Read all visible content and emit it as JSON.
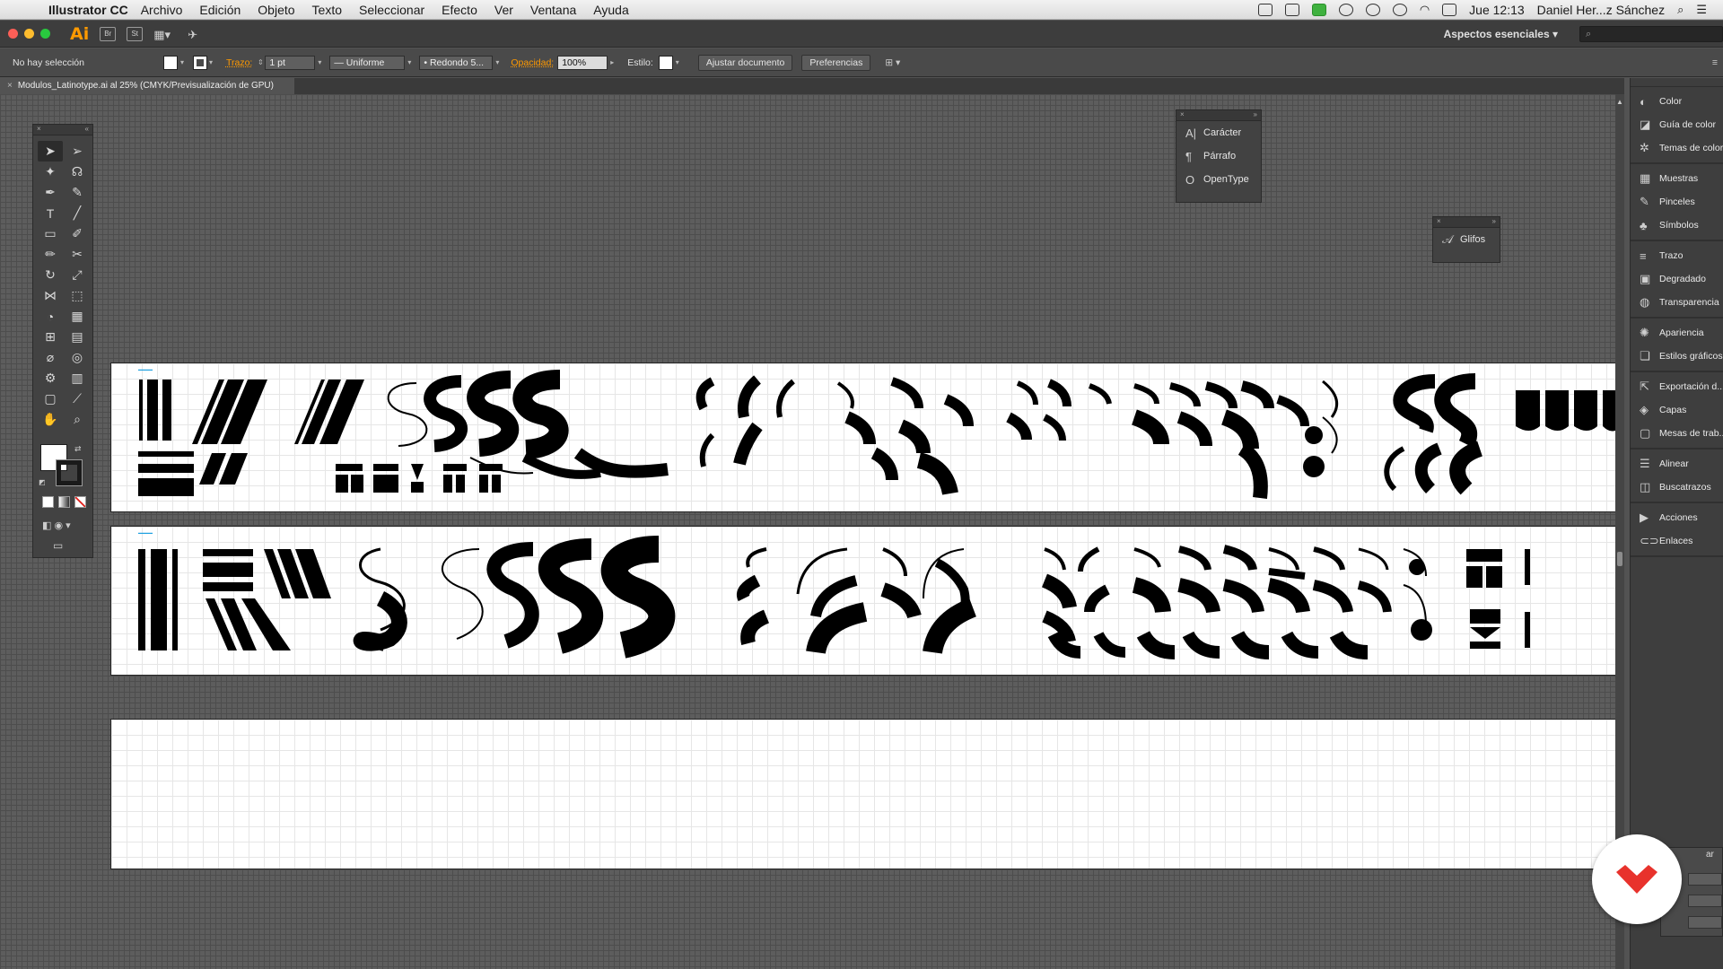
{
  "menubar": {
    "app_name": "Illustrator CC",
    "items": [
      "Archivo",
      "Edición",
      "Objeto",
      "Texto",
      "Seleccionar",
      "Efecto",
      "Ver",
      "Ventana",
      "Ayuda"
    ],
    "clock": "Jue 12:13",
    "user": "Daniel Her...z Sánchez"
  },
  "appbar": {
    "logo": "Ai",
    "bridge": "Br",
    "stock": "St",
    "workspace": "Aspectos esenciales"
  },
  "controlbar": {
    "selection": "No hay selección",
    "stroke_label": "Trazo:",
    "stroke_value": "1 pt",
    "profile": "Uniforme",
    "brush": "Redondo 5...",
    "opacity_label": "Opacidad:",
    "opacity_value": "100%",
    "style_label": "Estilo:",
    "doc_setup": "Ajustar documento",
    "preferences": "Preferencias"
  },
  "document": {
    "tab_title": "Modulos_Latinotype.ai al 25% (CMYK/Previsualización de GPU)"
  },
  "floating": {
    "type_panel": [
      "Carácter",
      "Párrafo",
      "OpenType"
    ],
    "glyphs": "Glifos"
  },
  "dock": {
    "groups": [
      [
        "Color",
        "Guía de color",
        "Temas de color"
      ],
      [
        "Muestras",
        "Pinceles",
        "Símbolos"
      ],
      [
        "Trazo",
        "Degradado",
        "Transparencia"
      ],
      [
        "Apariencia",
        "Estilos gráficos"
      ],
      [
        "Exportación d...",
        "Capas",
        "Mesas de trab..."
      ],
      [
        "Alinear",
        "Buscatrazos"
      ],
      [
        "Acciones",
        "Enlaces"
      ]
    ]
  },
  "partial_panel": {
    "tab": "ar"
  },
  "colors": {
    "accent": "#ff9a00",
    "brand": "#e8322c",
    "canvas": "#5d5d5d"
  }
}
